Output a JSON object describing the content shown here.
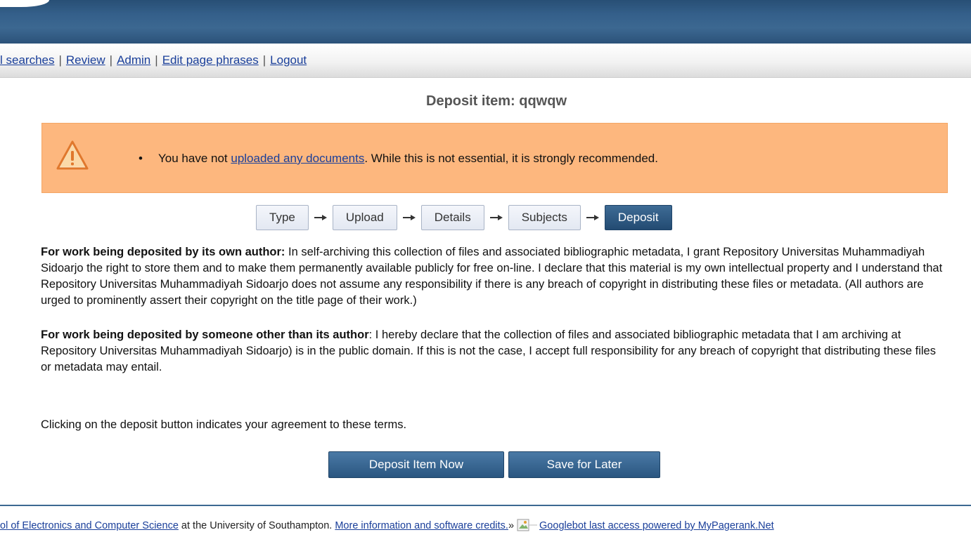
{
  "menu": {
    "links": [
      "l searches",
      "Review",
      "Admin",
      "Edit page phrases",
      "Logout"
    ],
    "separator": "|"
  },
  "page_title": "Deposit item: qqwqw",
  "warning": {
    "icon": "warning-triangle-icon",
    "text_before": "You have not ",
    "link_text": "uploaded any documents",
    "text_after": ". While this is not essential, it is strongly recommended.",
    "bullet": "•",
    "background_color": "#fdb77e"
  },
  "steps": {
    "labels": [
      "Type",
      "Upload",
      "Details",
      "Subjects",
      "Deposit"
    ],
    "active": "Deposit",
    "arrow_icon": "right-arrow-icon"
  },
  "terms": {
    "own_author_heading": "For work being deposited by its own author:",
    "own_author_text": " In self-archiving this collection of files and associated bibliographic metadata, I grant Repository Universitas Muhammadiyah Sidoarjo the right to store them and to make them permanently available publicly for free on-line. I declare that this material is my own intellectual property and I understand that Repository Universitas Muhammadiyah Sidoarjo does not assume any responsibility if there is any breach of copyright in distributing these files or metadata. (All authors are urged to prominently assert their copyright on the title page of their work.)",
    "other_author_heading": "For work being deposited by someone other than its author",
    "other_author_text": ": I hereby declare that the collection of files and associated bibliographic metadata that I am archiving at Repository Universitas Muhammadiyah Sidoarjo) is in the public domain. If this is not the case, I accept full responsibility for any breach of copyright that distributing these files or metadata may entail.",
    "agreement_text": "Clicking on the deposit button indicates your agreement to these terms."
  },
  "buttons": {
    "deposit_now": "Deposit Item Now",
    "save_later": "Save for Later"
  },
  "footer": {
    "school_link": "ol of Electronics and Computer Science",
    "text_middle": " at the University of Southampton. ",
    "credits_link": "More information and software credits.",
    "arrow": "»",
    "googlebot_link": "Googlebot last access powered by MyPagerank.Net",
    "broken_image_icon": "broken-image-icon"
  },
  "colors": {
    "header_blue": "#345f8a",
    "link_blue": "#1a3f9a",
    "active_step": "#2a5680"
  }
}
